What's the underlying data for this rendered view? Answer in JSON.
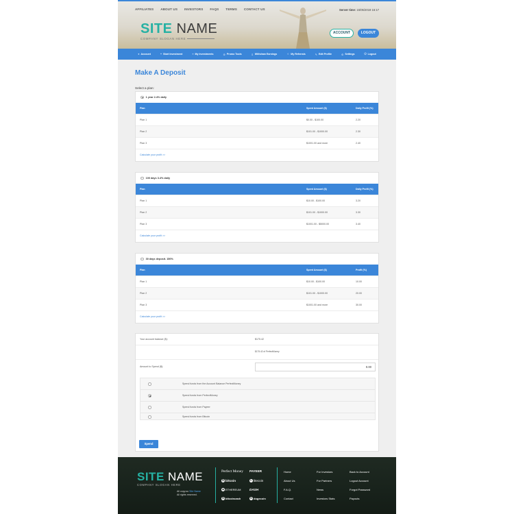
{
  "top_nav": [
    "AFFILIATES",
    "ABOUT US",
    "INVESTORS",
    "FAQS",
    "TERMS",
    "CONTACT US"
  ],
  "server_time": {
    "label": "Server time:",
    "value": "15/05/2019 16:17"
  },
  "logo": {
    "site": "SITE",
    "name": "NAME",
    "slogan": "COMPANY SLOGAN HERE"
  },
  "header_buttons": {
    "account": "ACCOUNT",
    "logout": "LOGOUT"
  },
  "menu": [
    {
      "icon": "user-icon",
      "glyph": "●",
      "label": "Account"
    },
    {
      "icon": "plus-icon",
      "glyph": "+",
      "label": "Start Investment"
    },
    {
      "icon": "list-icon",
      "glyph": "≡",
      "label": "My Investments"
    },
    {
      "icon": "tools-icon",
      "glyph": "⚙",
      "label": "Promo Tools"
    },
    {
      "icon": "withdraw-icon",
      "glyph": "⇩",
      "label": "Withdraw Earnings"
    },
    {
      "icon": "referrals-icon",
      "glyph": "☺",
      "label": "My Referrals"
    },
    {
      "icon": "edit-icon",
      "glyph": "✎",
      "label": "Edit Profile"
    },
    {
      "icon": "settings-icon",
      "glyph": "⚙",
      "label": "Settings"
    },
    {
      "icon": "logout-icon",
      "glyph": "⏻",
      "label": "Logout"
    }
  ],
  "page_title": "Make A Deposit",
  "select_label": "Select a plan:",
  "plans": [
    {
      "name": "1 year 2.4% daily",
      "checked": true,
      "columns": [
        "Plan",
        "Spent Amount ($)",
        "Daily Profit (%)"
      ],
      "rows": [
        [
          "Plan 1",
          "$0.00 - $100.00",
          "2.20"
        ],
        [
          "Plan 2",
          "$101.00 - $1000.00",
          "2.30"
        ],
        [
          "Plan 3",
          "$1001.00 and more",
          "2.40"
        ]
      ],
      "calc_link": "Calculate your profit >>"
    },
    {
      "name": "100 days 3.4% daily",
      "checked": false,
      "columns": [
        "Plan",
        "Spent Amount ($)",
        "Daily Profit (%)"
      ],
      "rows": [
        [
          "Plan 1",
          "$10.00 - $100.00",
          "3.20"
        ],
        [
          "Plan 2",
          "$101.00 - $1000.00",
          "3.30"
        ],
        [
          "Plan 3",
          "$1001.00 - $5000.00",
          "3.40"
        ]
      ],
      "calc_link": "Calculate your profit >>"
    },
    {
      "name": "30 days deposit. 150%",
      "checked": false,
      "columns": [
        "Plan",
        "Spent Amount ($)",
        "Profit (%)"
      ],
      "rows": [
        [
          "Plan 1",
          "$10.00 - $100.00",
          "10.00"
        ],
        [
          "Plan 2",
          "$101.00 - $1000.00",
          "20.00"
        ],
        [
          "Plan 3",
          "$1001.00 and more",
          "30.00"
        ]
      ],
      "calc_link": "Calculate your profit >>"
    }
  ],
  "balance": {
    "label": "Your account balance ($):",
    "value": "$175.42",
    "sub_value": "$175.42 of PerfectMoney",
    "amount_label": "Amount to Spend ($):",
    "amount_value": "0.00"
  },
  "spend_options": [
    {
      "label": "Spend funds from the Account Balance PerfectMoney",
      "checked": false
    },
    {
      "label": "Spend funds from PerfectMoney",
      "checked": true
    },
    {
      "label": "Spend funds from Payeer",
      "checked": false
    },
    {
      "label": "Spend funds from Bitcoin",
      "checked": false
    }
  ],
  "spend_button": "Spend",
  "footer": {
    "copy_line1": "All rights reserved.",
    "copy_prefix": "All copy.so",
    "copy_site": "Site Name",
    "payments": [
      "Perfect Money",
      "PAYEER",
      "bitcoin",
      "litecoin",
      "ETHEREUM",
      "DASH",
      "bitcoincash",
      "dogecoin"
    ],
    "links": [
      [
        "Home",
        "For Investors",
        "Back to Account"
      ],
      [
        "About Us",
        "For Partners",
        "Logout Account"
      ],
      [
        "F.A.Q.",
        "News",
        "Forgot Password"
      ],
      [
        "Contact",
        "Investors Stats",
        "Payouts"
      ]
    ]
  },
  "colors": {
    "accent": "#3b86d9",
    "brand": "#26b1a3",
    "footer_bg": "#1b241d"
  }
}
